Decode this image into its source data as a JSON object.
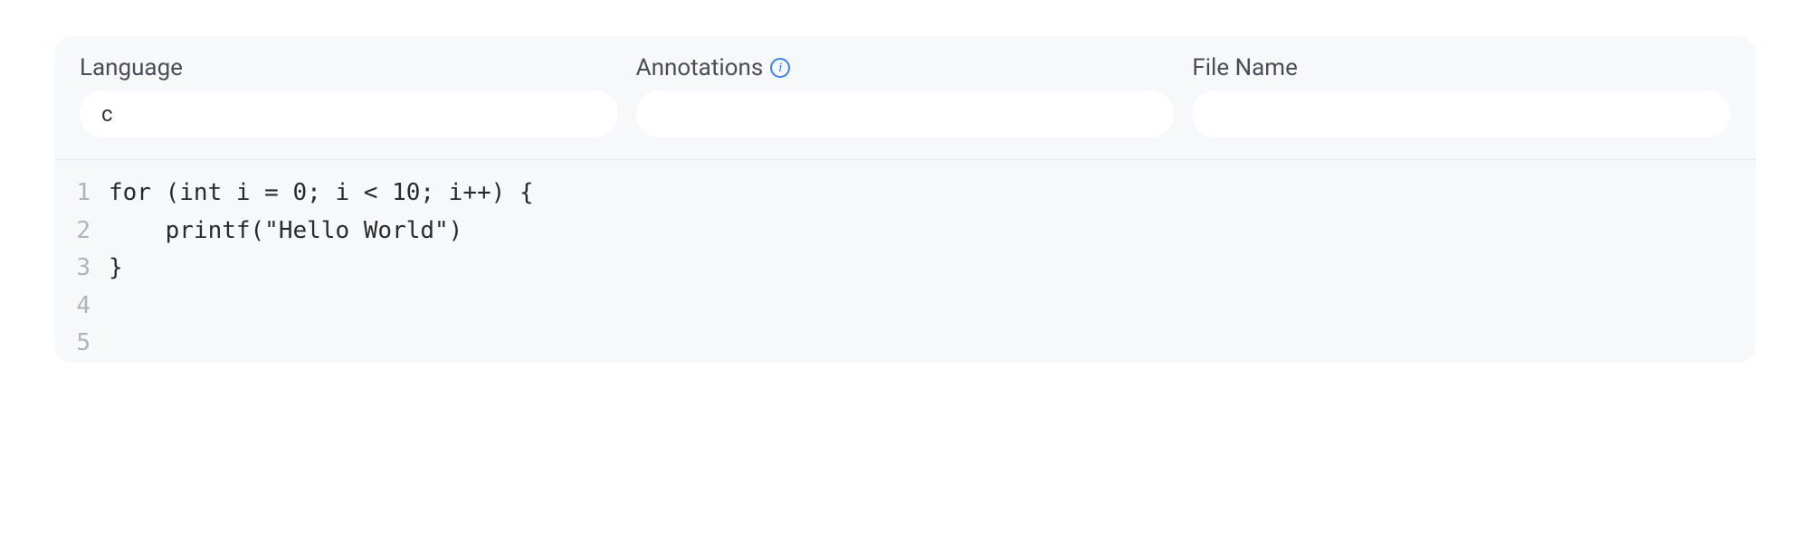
{
  "fields": {
    "language": {
      "label": "Language",
      "value": "c"
    },
    "annotations": {
      "label": "Annotations",
      "value": ""
    },
    "filename": {
      "label": "File Name",
      "value": ""
    }
  },
  "code": {
    "lines": [
      {
        "n": "1",
        "text": "for (int i = 0; i < 10; i++) {"
      },
      {
        "n": "2",
        "text": "    printf(\"Hello World\")"
      },
      {
        "n": "3",
        "text": "}"
      },
      {
        "n": "4",
        "text": ""
      },
      {
        "n": "5",
        "text": ""
      }
    ]
  }
}
